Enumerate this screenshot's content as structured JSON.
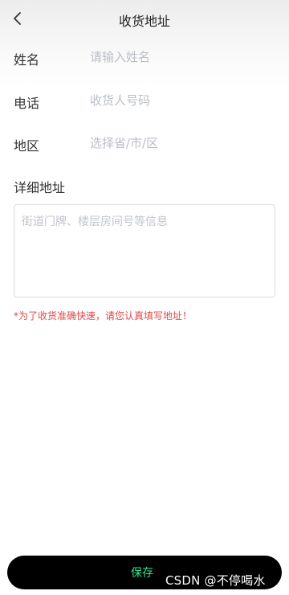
{
  "header": {
    "title": "收货地址",
    "back_icon": "chevron-left-icon"
  },
  "form": {
    "name": {
      "label": "姓名",
      "placeholder": "请输入姓名",
      "value": ""
    },
    "phone": {
      "label": "电话",
      "placeholder": "收货人号码",
      "value": ""
    },
    "region": {
      "label": "地区",
      "placeholder": "选择省/市/区",
      "value": ""
    },
    "detail": {
      "label": "详细地址",
      "placeholder": "街道门牌、楼层房间号等信息",
      "value": ""
    }
  },
  "tip": "*为了收货准确快速，请您认真填写地址！",
  "save_button": {
    "label": "保存"
  },
  "watermark": "CSDN @不停喝水",
  "colors": {
    "tip": "#e0474c",
    "button_bg": "#000000",
    "button_text": "#2ee78e",
    "placeholder": "#b9bec6"
  }
}
